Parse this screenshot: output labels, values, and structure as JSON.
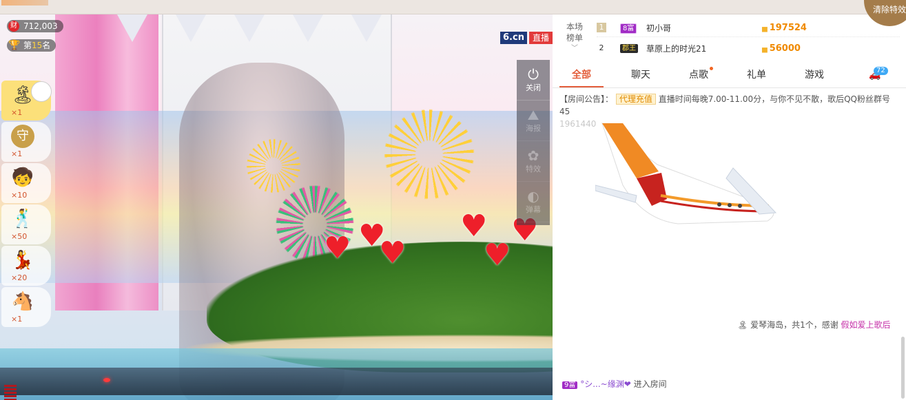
{
  "stage": {
    "wealth_icon": "财",
    "wealth_value": "712,003",
    "rank_prefix": "第",
    "rank_number": "15",
    "rank_suffix": "名",
    "logo": "6.cn",
    "live_label": "直播",
    "gifts": [
      {
        "icon": "island-icon",
        "glyph": "🏝",
        "count": "×1"
      },
      {
        "icon": "shield-icon",
        "glyph": "守",
        "count": "×1"
      },
      {
        "icon": "character-icon",
        "glyph": "🧒",
        "count": "×10"
      },
      {
        "icon": "dancer-icon",
        "glyph": "🕺",
        "count": "×50"
      },
      {
        "icon": "dancer-icon",
        "glyph": "💃",
        "count": "×20"
      },
      {
        "icon": "horse-icon",
        "glyph": "🐴",
        "count": "×1"
      }
    ],
    "video_tools": [
      {
        "icon": "power-icon",
        "glyph": "⏻",
        "label": "关闭"
      },
      {
        "icon": "landscape-icon",
        "glyph": "⛰",
        "label": "海报"
      },
      {
        "icon": "flower-icon",
        "glyph": "✿",
        "label": "特效"
      },
      {
        "icon": "toggle-icon",
        "glyph": "◐",
        "label": "弹幕"
      }
    ]
  },
  "ranking": {
    "title_line1": "本场",
    "title_line2": "榜单",
    "rows": [
      {
        "num": "1",
        "level": "8富",
        "name": "初小哥",
        "coins": "197524"
      },
      {
        "num": "2",
        "level": "郡王",
        "name": "草原上的时光21",
        "coins": "56000"
      }
    ]
  },
  "tabs": [
    "全部",
    "聊天",
    "点歌",
    "礼单",
    "游戏"
  ],
  "car_badge": "72",
  "clear_button": "清除特效",
  "chat": {
    "announce_label": "【房间公告】：",
    "announce_tag": "代理充值",
    "announce_text": "直播时间每晚7.00-11.00分，与你不见不散，歌后QQ粉丝群号45",
    "announce_text2": "1961440",
    "thanks_text": "爱琴海岛，共1个，感谢",
    "thanks_name": "假如爱上歌后",
    "enter_level": "9富",
    "enter_nick": "°シ...~缘渊❤",
    "enter_text": "进入房间"
  }
}
